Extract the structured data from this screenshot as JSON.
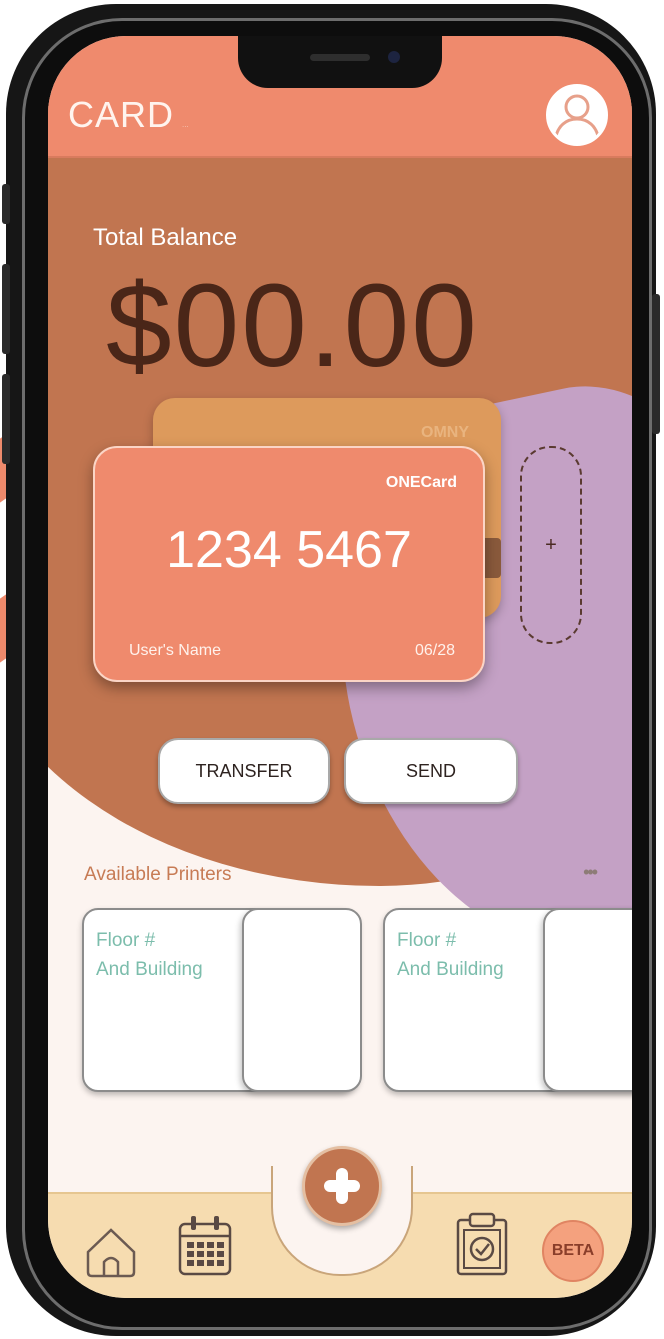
{
  "header": {
    "app_title": "CARD",
    "app_title_suffix": "..."
  },
  "balance": {
    "label": "Total Balance",
    "value": "$00.00"
  },
  "cards": {
    "back_card_label": "OMNY",
    "front_card": {
      "brand": "ONECard",
      "number": "1234 5467",
      "holder_name": "User's Name",
      "expiry": "06/28"
    },
    "add_card_symbol": "+"
  },
  "actions": {
    "transfer_label": "TRANSFER",
    "send_label": "SEND"
  },
  "printers": {
    "section_title": "Available Printers",
    "more_label": "•••",
    "items": [
      {
        "line1": "Floor #",
        "line2": "And Building"
      },
      {
        "line1": "Floor #",
        "line2": "And Building"
      }
    ]
  },
  "nav": {
    "items": [
      {
        "icon": "home-icon"
      },
      {
        "icon": "calendar-icon"
      },
      {
        "icon": "add-icon"
      },
      {
        "icon": "clipboard-check-icon"
      }
    ],
    "beta_label": "BETA"
  },
  "colors": {
    "header": "#ef8a6d",
    "brown": "#c17550",
    "purple": "#c4a1c5",
    "card": "#ef8a6d",
    "nav": "#f6dcb0",
    "accent_text": "#c77b55",
    "printer_text": "#7cbdac"
  }
}
